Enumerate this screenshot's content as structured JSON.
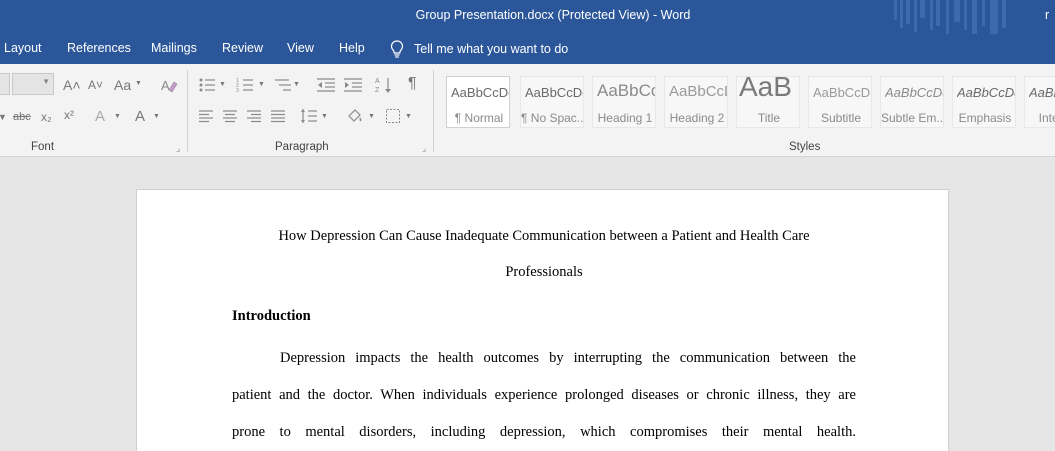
{
  "window": {
    "title": "Group Presentation.docx (Protected View)  -  Word",
    "user_initial": "r"
  },
  "tabs": {
    "items": [
      "Layout",
      "References",
      "Mailings",
      "Review",
      "View",
      "Help"
    ],
    "tell_me": "Tell me what you want to do"
  },
  "ribbon": {
    "font_group_label": "Font",
    "paragraph_group_label": "Paragraph",
    "styles_group_label": "Styles",
    "font_size_value": "",
    "font_buttons": {
      "grow": "A˄",
      "shrink": "A˅",
      "change_case": "Aa",
      "strikethrough": "abc",
      "subscript": "x₂",
      "superscript": "x²",
      "text_effects": "A",
      "font_color": "A"
    },
    "styles": [
      {
        "sample": "AaBbCcDc",
        "name": "¶ Normal"
      },
      {
        "sample": "AaBbCcDc",
        "name": "¶ No Spac..."
      },
      {
        "sample": "AaBbCc",
        "name": "Heading 1"
      },
      {
        "sample": "AaBbCcD",
        "name": "Heading 2"
      },
      {
        "sample": "AaB",
        "name": "Title"
      },
      {
        "sample": "AaBbCcD",
        "name": "Subtitle"
      },
      {
        "sample": "AaBbCcDd",
        "name": "Subtle Em..."
      },
      {
        "sample": "AaBbCcDd",
        "name": "Emphasis"
      },
      {
        "sample": "AaBbCcDd",
        "name": "Inten..."
      }
    ]
  },
  "document": {
    "title_line1": "How Depression Can Cause Inadequate Communication between a Patient and Health Care",
    "title_line2": "Professionals",
    "heading": "Introduction",
    "para_line1": "Depression impacts the health outcomes by interrupting the communication between the",
    "para_line2": "patient and the doctor. When individuals experience prolonged diseases or chronic illness, they are",
    "para_line3": "prone to mental disorders, including depression, which compromises their mental health."
  },
  "colors": {
    "title_bar": "#2b579a",
    "ribbon_bg": "#f3f3f3",
    "canvas_bg": "#e6e6e6",
    "page_bg": "#ffffff"
  }
}
